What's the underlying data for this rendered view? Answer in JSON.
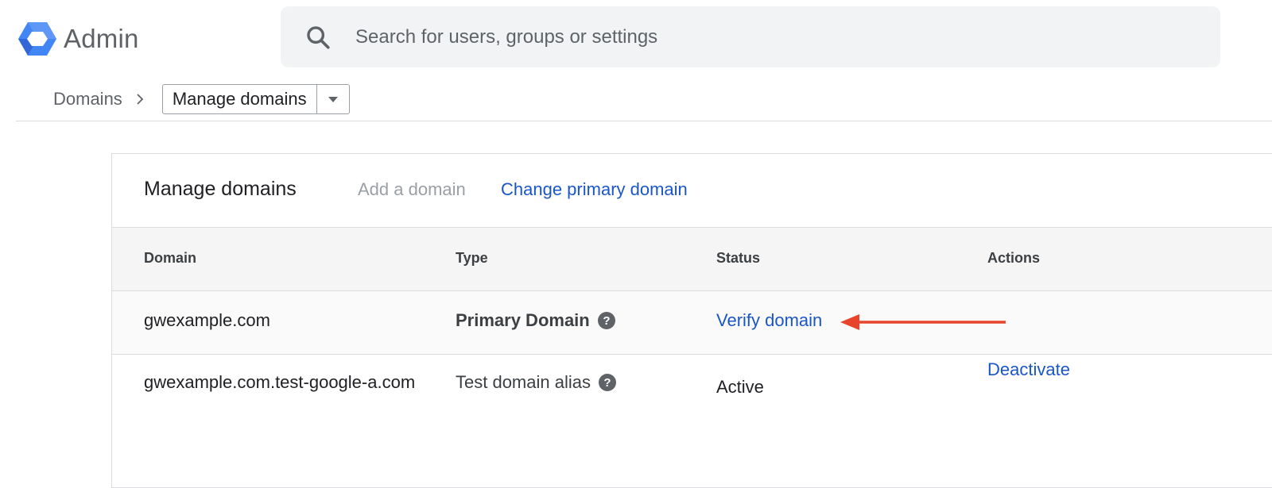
{
  "app": {
    "logo_text": "Admin"
  },
  "search": {
    "placeholder": "Search for users, groups or settings"
  },
  "breadcrumb": {
    "root": "Domains",
    "current": "Manage domains"
  },
  "card": {
    "title": "Manage domains",
    "add_domain": "Add a domain",
    "change_primary": "Change primary domain"
  },
  "table": {
    "headers": [
      "Domain",
      "Type",
      "Status",
      "Actions"
    ],
    "rows": [
      {
        "domain": "gwexample.com",
        "type": "Primary Domain",
        "status": "Verify domain",
        "action": ""
      },
      {
        "domain": "gwexample.com.test-google-a.com",
        "type": "Test domain alias",
        "status": "Active",
        "action": "Deactivate"
      }
    ]
  },
  "colors": {
    "link": "#1a56c9",
    "annotation_arrow": "#e8442c",
    "logo_blue": "#4285f4"
  },
  "icons": [
    "admin-logo-icon",
    "search-icon",
    "chevron-right-icon",
    "caret-down-icon",
    "help-icon",
    "annotation-arrow-icon"
  ]
}
